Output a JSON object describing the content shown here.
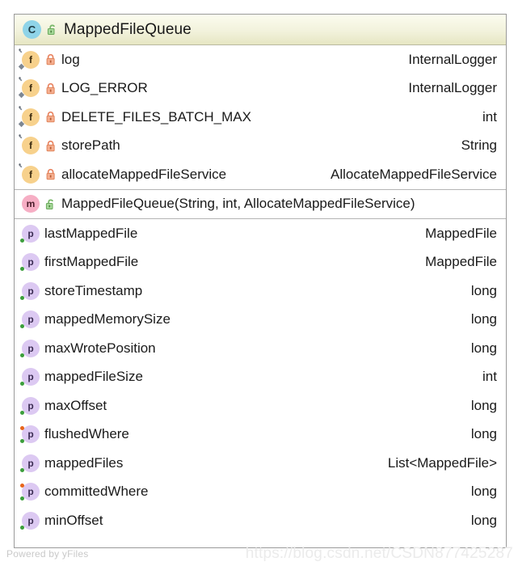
{
  "diagram": {
    "kind": "uml-class-diagram",
    "class_icon": "class-icon",
    "class_visibility_icon": "unlocked-padlock-icon",
    "title": "MappedFileQueue",
    "header_gradient_top": "#fbfcef",
    "header_gradient_bottom": "#e6e6c3",
    "border_color": "#9a9a9a"
  },
  "sections": [
    {
      "name": "fields",
      "rows": [
        {
          "kind": "f",
          "kind_label": "field-icon",
          "static": true,
          "wrench": true,
          "diamond": true,
          "visibility_icon": "locked-padlock-icon",
          "visibility": "private",
          "name": "log",
          "type": "InternalLogger"
        },
        {
          "kind": "f",
          "kind_label": "field-icon",
          "static": true,
          "wrench": true,
          "diamond": true,
          "visibility_icon": "locked-padlock-icon",
          "visibility": "private",
          "name": "LOG_ERROR",
          "type": "InternalLogger"
        },
        {
          "kind": "f",
          "kind_label": "field-icon",
          "static": true,
          "wrench": true,
          "diamond": true,
          "visibility_icon": "locked-padlock-icon",
          "visibility": "private",
          "name": "DELETE_FILES_BATCH_MAX",
          "type": "int"
        },
        {
          "kind": "f",
          "kind_label": "field-icon",
          "static": true,
          "wrench": true,
          "diamond": false,
          "visibility_icon": "locked-padlock-icon",
          "visibility": "private",
          "name": "storePath",
          "type": "String"
        },
        {
          "kind": "f",
          "kind_label": "field-icon",
          "static": true,
          "wrench": true,
          "diamond": false,
          "visibility_icon": "locked-padlock-icon",
          "visibility": "private",
          "name": "allocateMappedFileService",
          "type": "AllocateMappedFileService"
        }
      ]
    },
    {
      "name": "constructors",
      "rows": [
        {
          "kind": "m",
          "kind_label": "method-icon",
          "static": false,
          "visibility_icon": "unlocked-padlock-icon",
          "visibility": "public",
          "name": "MappedFileQueue(String, int, AllocateMappedFileService)",
          "type": ""
        }
      ]
    },
    {
      "name": "properties",
      "rows": [
        {
          "kind": "p",
          "kind_label": "property-icon",
          "getter": true,
          "setter": false,
          "name": "lastMappedFile",
          "type": "MappedFile"
        },
        {
          "kind": "p",
          "kind_label": "property-icon",
          "getter": true,
          "setter": false,
          "name": "firstMappedFile",
          "type": "MappedFile"
        },
        {
          "kind": "p",
          "kind_label": "property-icon",
          "getter": true,
          "setter": false,
          "name": "storeTimestamp",
          "type": "long"
        },
        {
          "kind": "p",
          "kind_label": "property-icon",
          "getter": true,
          "setter": false,
          "name": "mappedMemorySize",
          "type": "long"
        },
        {
          "kind": "p",
          "kind_label": "property-icon",
          "getter": true,
          "setter": false,
          "name": "maxWrotePosition",
          "type": "long"
        },
        {
          "kind": "p",
          "kind_label": "property-icon",
          "getter": true,
          "setter": false,
          "name": "mappedFileSize",
          "type": "int"
        },
        {
          "kind": "p",
          "kind_label": "property-icon",
          "getter": true,
          "setter": false,
          "name": "maxOffset",
          "type": "long"
        },
        {
          "kind": "p",
          "kind_label": "property-icon",
          "getter": true,
          "setter": true,
          "name": "flushedWhere",
          "type": "long"
        },
        {
          "kind": "p",
          "kind_label": "property-icon",
          "getter": true,
          "setter": false,
          "name": "mappedFiles",
          "type": "List<MappedFile>"
        },
        {
          "kind": "p",
          "kind_label": "property-icon",
          "getter": true,
          "setter": true,
          "name": "committedWhere",
          "type": "long"
        },
        {
          "kind": "p",
          "kind_label": "property-icon",
          "getter": true,
          "setter": false,
          "name": "minOffset",
          "type": "long"
        }
      ]
    }
  ],
  "footer": {
    "powered_by": "Powered by yFiles",
    "watermark": "https://blog.csdn.net/CSDN877425287"
  }
}
